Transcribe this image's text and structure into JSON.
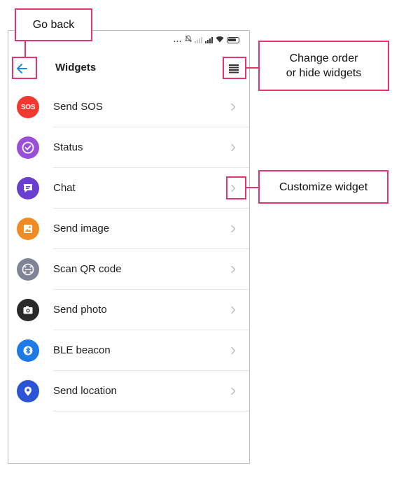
{
  "header": {
    "title": "Widgets",
    "back_icon": "arrow-left-icon",
    "menu_icon": "reorder-list-icon"
  },
  "statusbar": {
    "dots": "..."
  },
  "widgets": [
    {
      "label": "Send SOS",
      "icon": "sos-icon",
      "badge_text": "SOS",
      "color": "#f2392f"
    },
    {
      "label": "Status",
      "icon": "check-circle-icon",
      "color": "#9a4fd9"
    },
    {
      "label": "Chat",
      "icon": "chat-bubble-icon",
      "color": "#6a3fd0"
    },
    {
      "label": "Send image",
      "icon": "image-icon",
      "color": "#f08b23"
    },
    {
      "label": "Scan QR code",
      "icon": "scan-qr-icon",
      "color": "#7f8396"
    },
    {
      "label": "Send photo",
      "icon": "camera-icon",
      "color": "#2a2a2a"
    },
    {
      "label": "BLE beacon",
      "icon": "bluetooth-icon",
      "color": "#1c7be6"
    },
    {
      "label": "Send location",
      "icon": "location-pin-icon",
      "color": "#2c55d6"
    }
  ],
  "callouts": {
    "go_back": "Go back",
    "change_order_line1": "Change order",
    "change_order_line2": "or hide widgets",
    "customize": "Customize widget"
  },
  "colors": {
    "accent": "#e8336b",
    "back_arrow": "#1e88e5"
  }
}
